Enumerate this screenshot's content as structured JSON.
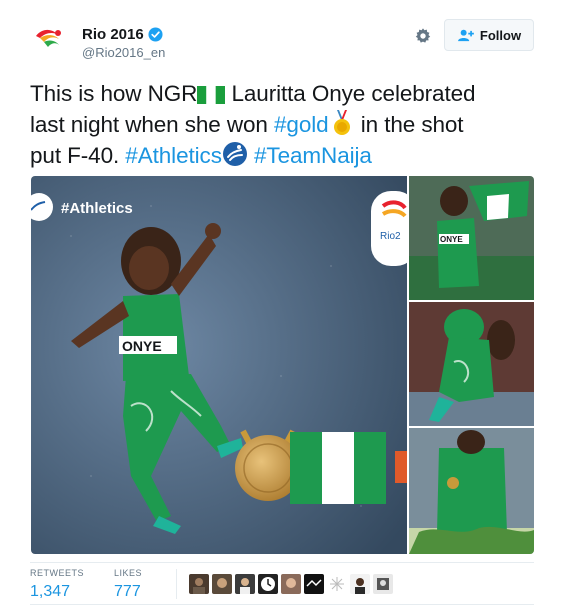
{
  "account": {
    "display_name": "Rio 2016",
    "handle": "@Rio2016_en",
    "verified": true,
    "avatar_icon": "rio2016-logo-icon"
  },
  "actions": {
    "settings_icon": "gear-icon",
    "follow_label": "Follow"
  },
  "tweet": {
    "line1": {
      "text": "This is how NGR",
      "after_flag": " Lauritta Onye celebrated"
    },
    "line2": {
      "before": "last night when she won ",
      "hashtag": "#gold",
      "after": " in the shot"
    },
    "line3": {
      "before": "put F-40. ",
      "hashtag1": "#Athletics",
      "hashtag2": "#TeamNaija"
    },
    "emojis": [
      "nigeria-flag-emoji",
      "gold-medal-emoji",
      "athletics-emoji"
    ]
  },
  "media": {
    "main_tag": "#Athletics",
    "bib_name": "ONYE",
    "side_bib": "ONYE",
    "colors": {
      "green": "#1e9a4f",
      "track_blue": "#3f5a78",
      "gold": "#c89a3a"
    }
  },
  "stats": {
    "retweets_label": "RETWEETS",
    "retweets_value": "1,347",
    "likes_label": "LIKES",
    "likes_value": "777"
  },
  "likers": [
    "liker-avatar-1",
    "liker-avatar-2",
    "liker-avatar-3",
    "liker-avatar-4",
    "liker-avatar-5",
    "liker-avatar-6",
    "liker-avatar-7",
    "liker-avatar-8",
    "liker-avatar-9"
  ]
}
